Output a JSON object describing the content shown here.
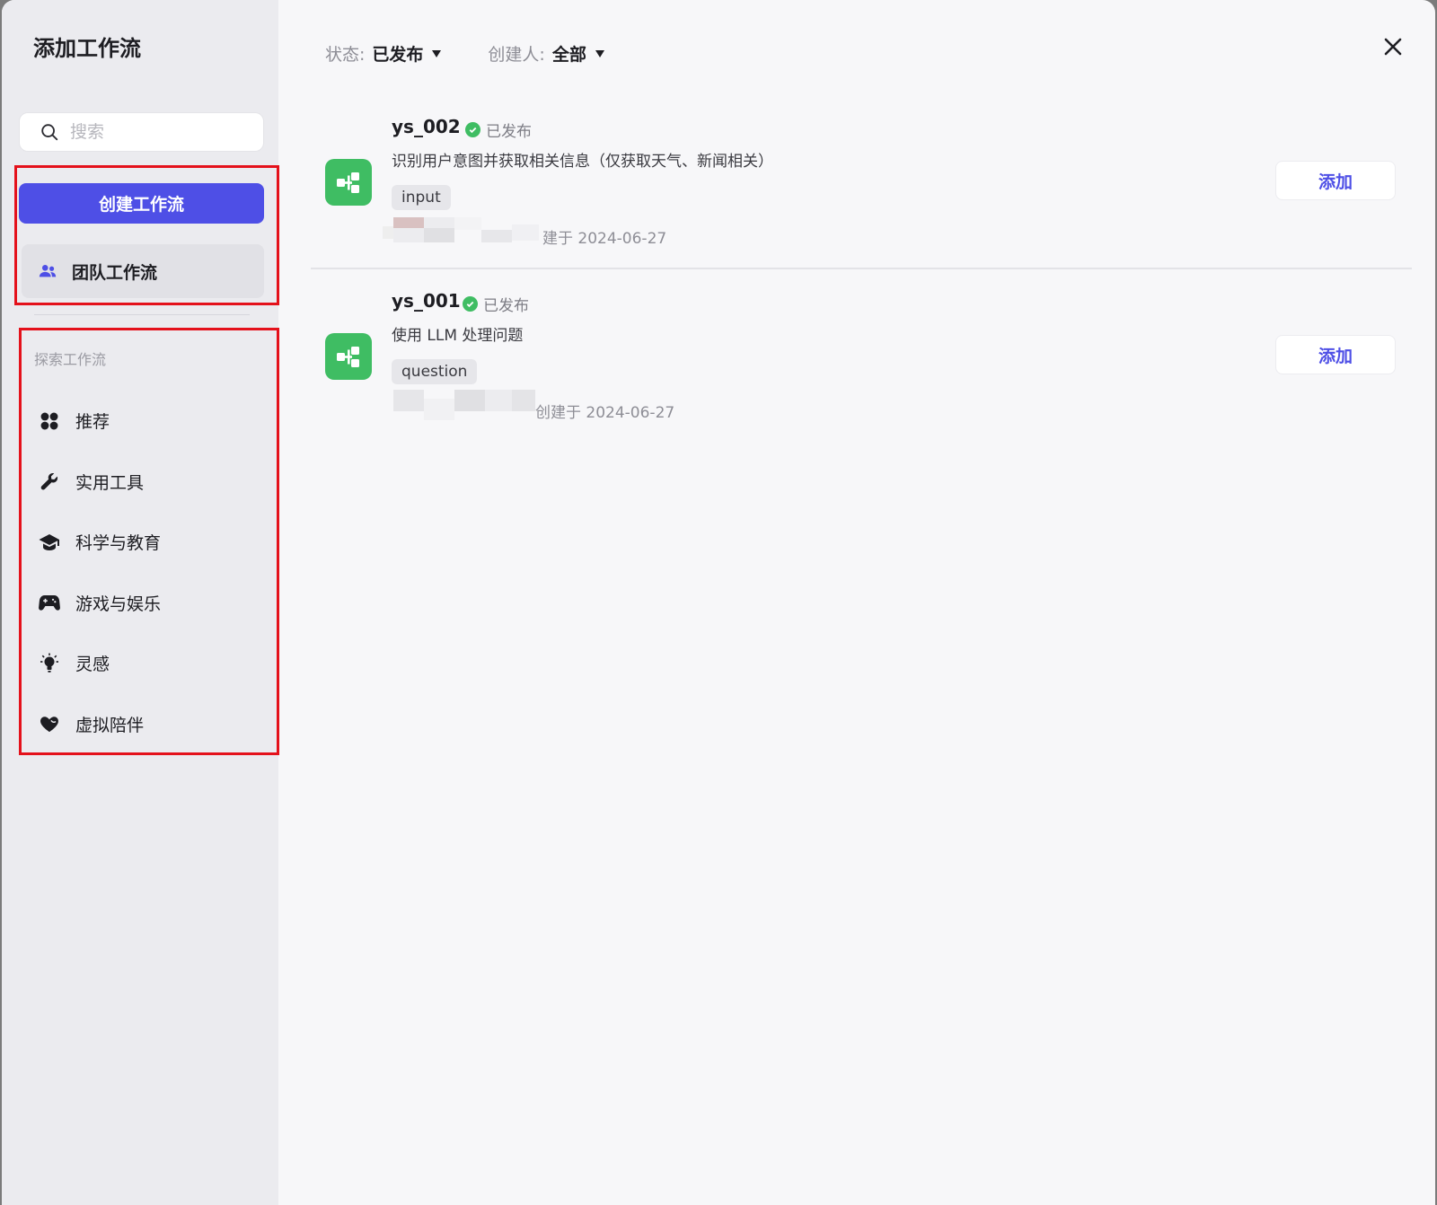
{
  "dialog": {
    "title": "添加工作流"
  },
  "search": {
    "placeholder": "搜索"
  },
  "sidebar": {
    "create_label": "创建工作流",
    "team_label": "团队工作流",
    "section_label": "探索工作流",
    "categories": [
      {
        "label": "推荐",
        "icon": "grid-icon"
      },
      {
        "label": "实用工具",
        "icon": "wrench-icon"
      },
      {
        "label": "科学与教育",
        "icon": "graduation-cap-icon"
      },
      {
        "label": "游戏与娱乐",
        "icon": "gamepad-icon"
      },
      {
        "label": "灵感",
        "icon": "lightbulb-icon"
      },
      {
        "label": "虚拟陪伴",
        "icon": "heart-icon"
      }
    ]
  },
  "filters": {
    "status": {
      "key": "状态:",
      "value": "已发布"
    },
    "creator": {
      "key": "创建人:",
      "value": "全部"
    }
  },
  "workflows": [
    {
      "name": "ys_002",
      "status": "已发布",
      "description": "识别用户意图并获取相关信息（仅获取天气、新闻相关）",
      "tag": "input",
      "meta": "建于 2024-06-27",
      "add_label": "添加"
    },
    {
      "name": "ys_001",
      "status": "已发布",
      "description": "使用 LLM 处理问题",
      "tag": "question",
      "meta": "创建于 2024-06-27",
      "add_label": "添加"
    }
  ],
  "colors": {
    "accent": "#4e4fe6",
    "success": "#3fbd63",
    "highlight": "#e4111b"
  }
}
